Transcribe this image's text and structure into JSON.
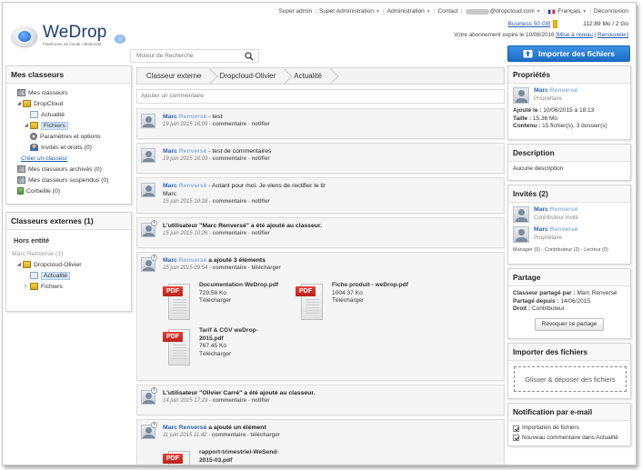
{
  "header": {
    "nav": {
      "super_admin": "Super admin",
      "super_administration": "Super Administration",
      "administration": "Administration",
      "contact": "Contact",
      "email_domain": "@dropcloud.com",
      "language": "Français",
      "logout": "Déconnexion"
    },
    "storage": {
      "plan_link": "Business 50 GB",
      "usage": "112.89 Mo / 2 Go"
    },
    "expiry": {
      "text": "Votre abonnement expire le 10/08/2016",
      "upgrade": "[Mise à niveau",
      "renew": "Renouveler]"
    },
    "logo": {
      "name": "WeDrop",
      "tagline": "Plateforme de travail collaboratif"
    },
    "search": {
      "placeholder": "Moteur de Recherche"
    },
    "import_button": "Importer des fichiers"
  },
  "left": {
    "my_folders": {
      "title": "Mes classeurs",
      "items": [
        {
          "label": "Mes classeurs"
        },
        {
          "label": "DropCloud"
        },
        {
          "label": "Actualité"
        },
        {
          "label": "Fichiers"
        },
        {
          "label": "Paramètres et options"
        },
        {
          "label": "Invités et droits (0)"
        }
      ],
      "create_link": "Créer un classeur",
      "extra": [
        {
          "label": "Mes classeurs archivés (0)"
        },
        {
          "label": "Mes classeurs suspendus (0)"
        },
        {
          "label": "Corbeille (0)"
        }
      ]
    },
    "external": {
      "title": "Classeurs externes (1)",
      "subtitle": "Hors entité",
      "items": [
        {
          "label": "Marc Renversé (1)"
        },
        {
          "label": "Dropcloud-Olivier"
        },
        {
          "label": "Actualité"
        },
        {
          "label": "Fichiers"
        }
      ]
    }
  },
  "main": {
    "breadcrumb": [
      "Classeur externe",
      "Dropcloud-Olivier",
      "Actualité"
    ],
    "comment_placeholder": "Ajouter un commentaire",
    "actions": {
      "comment": "commentaire",
      "notify": "notifier",
      "download": "télécharger"
    },
    "feed": [
      {
        "user": "Marc",
        "user_last": "Renversé",
        "text": " - test",
        "date": "19 juin 2015 16:09"
      },
      {
        "user": "Marc",
        "user_last": "Renversé",
        "text": " - test de commentaires",
        "date": "19 juin 2015 16:09"
      },
      {
        "user": "Marc",
        "user_last": "Renversé",
        "text": " - Autant pour moi. Je viens de rectifier le tir",
        "extra": "Marc",
        "date": "15 juin 2015 10:28"
      },
      {
        "text": "L'utilisateur \"Marc Renversé\" a été ajouté au classeur.",
        "date": "15 juin 2015 10:26"
      },
      {
        "user": "Marc",
        "user_last": "Renversé",
        "text": " a ajouté 3 éléments",
        "date": "15 juin 2015 09:54"
      },
      {
        "text": "L'utilisateur \"Olivier Carré\" a été ajouté au classeur.",
        "date": "14 juin 2015 17:29"
      },
      {
        "user": "Marc Renversé",
        "text": " a ajouté un élément",
        "date": "11 juin 2015 11:42"
      }
    ],
    "files": [
      {
        "name": "Documentation WeDrop.pdf",
        "size": "729.58 Ko",
        "action": "Télécharger"
      },
      {
        "name": "Fiche produit - weDrop.pdf",
        "size": "1004.37 Ko",
        "action": "Télécharger"
      },
      {
        "name": "Tarif & CGV weDrop-2015.pdf",
        "size": "767.45 Ko",
        "action": "Télécharger"
      },
      {
        "name": "rapport-trimestriel-WeSend-2015-03.pdf"
      }
    ],
    "pdf_label": "PDF"
  },
  "right": {
    "props": {
      "title": "Propriétés",
      "owner_first": "Marc",
      "owner_last": "Renversé",
      "owner_role": "Propriétaire",
      "added": {
        "k": "Ajouté le :",
        "v": "10/06/2015 à 18:13"
      },
      "size": {
        "k": "Taille :",
        "v": "15.36 Mo"
      },
      "content": {
        "k": "Contenu :",
        "v": "15 fichier(s), 3 dossier(s)"
      }
    },
    "description": {
      "title": "Description",
      "text": "Aucune description"
    },
    "guests": {
      "title": "Invités (2)",
      "people": [
        {
          "first": "Marc",
          "last": "Renversé",
          "role": "Contributeur Invité"
        },
        {
          "first": "Marc",
          "last": "Renversé",
          "role": "Propriétaire"
        }
      ],
      "legend": "Manager (0) - Contributeur (2) - Lecteur (0)"
    },
    "share": {
      "title": "Partage",
      "shared_by": {
        "k": "Classeur partagé par :",
        "v": "Marc Renversé"
      },
      "since": {
        "k": "Partagé depuis :",
        "v": "14/06/2015"
      },
      "right": {
        "k": "Droit :",
        "v": "Contributeur"
      },
      "revoke": "Révoquer ce partage"
    },
    "import": {
      "title": "Importer des fichiers",
      "drop": "Glisser & déposer des fichiers"
    },
    "notify": {
      "title": "Notification par e-mail",
      "options": [
        "Importation de fichiers",
        "Nouveau commentaire dans Actualité"
      ]
    }
  },
  "colors": {
    "accent": "#1a6cc5",
    "link": "#2a62b8",
    "pdf": "#d42c25",
    "highlight": "#d4e6fb"
  }
}
